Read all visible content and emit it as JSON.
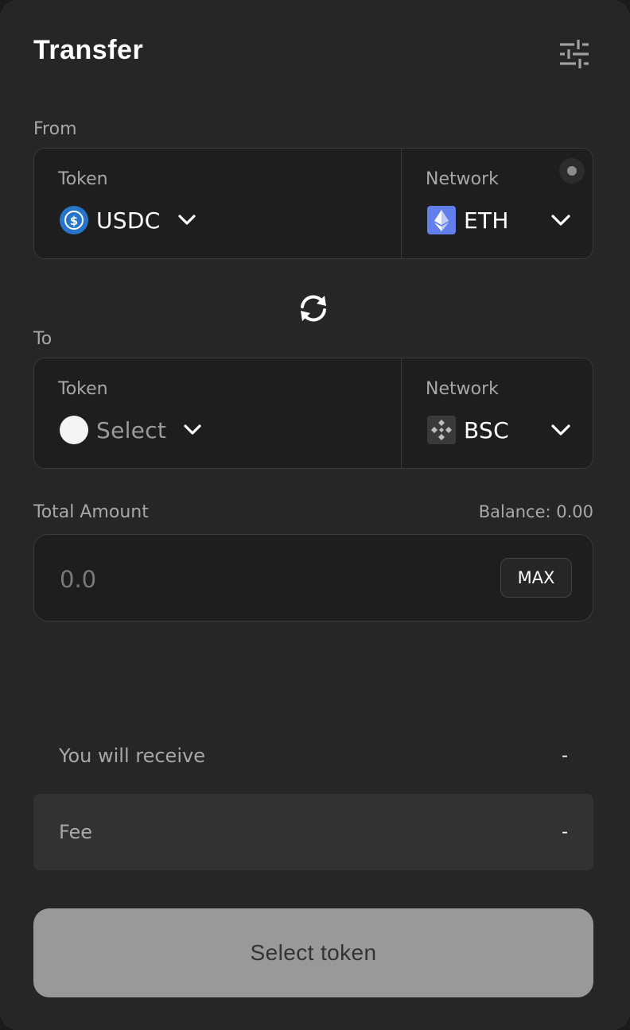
{
  "header": {
    "title": "Transfer",
    "settings_icon": "sliders-icon"
  },
  "from": {
    "label": "From",
    "token_caption": "Token",
    "token_value": "USDC",
    "token_icon": "usdc-icon",
    "network_caption": "Network",
    "network_value": "ETH",
    "network_icon": "ethereum-icon"
  },
  "swap_icon": "swap-arrows-icon",
  "to": {
    "label": "To",
    "token_caption": "Token",
    "token_value": "Select",
    "token_icon": "placeholder-token-icon",
    "network_caption": "Network",
    "network_value": "BSC",
    "network_icon": "bnb-chain-icon"
  },
  "amount": {
    "label": "Total Amount",
    "balance": "Balance: 0.00",
    "placeholder": "0.0",
    "max_label": "MAX"
  },
  "summary": {
    "receive_label": "You will receive",
    "receive_value": "-",
    "fee_label": "Fee",
    "fee_value": "-"
  },
  "cta_label": "Select token",
  "colors": {
    "background": "#262626",
    "panel": "#1e1e1e",
    "border": "#3a3a3a",
    "usdc_blue": "#2775ca",
    "eth_blue": "#627eea",
    "button_disabled": "#999999"
  }
}
